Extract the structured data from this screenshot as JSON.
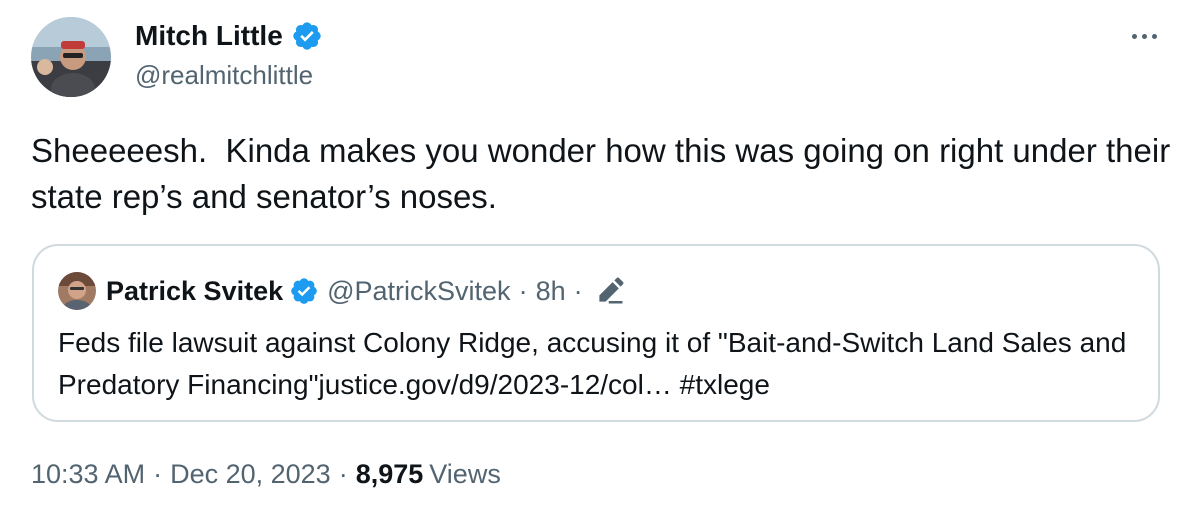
{
  "tweet": {
    "author_name": "Mitch Little",
    "author_handle": "@realmitchlittle",
    "text": "Sheeeeesh.  Kinda makes you wonder how this was going on right under their state rep’s and senator’s noses.",
    "verified_color": "#1d9bf0"
  },
  "quote": {
    "author_name": "Patrick Svitek",
    "author_handle": "@PatrickSvitek",
    "separator": "·",
    "time": "8h",
    "text_main": "Feds file lawsuit against Colony Ridge, accusing it of \"Bait-and-Switch Land Sales and Predatory Financing\"",
    "link": "justice.gov/d9/2023-12/col…",
    "hashtag": "#txlege"
  },
  "meta": {
    "time": "10:33 AM",
    "separator": "·",
    "date": "Dec 20, 2023",
    "views_count": "8,975",
    "views_label": "Views"
  },
  "icons": {
    "verified": "verified-badge-icon",
    "more": "more-dots-icon",
    "edit": "edit-pencil-icon"
  }
}
